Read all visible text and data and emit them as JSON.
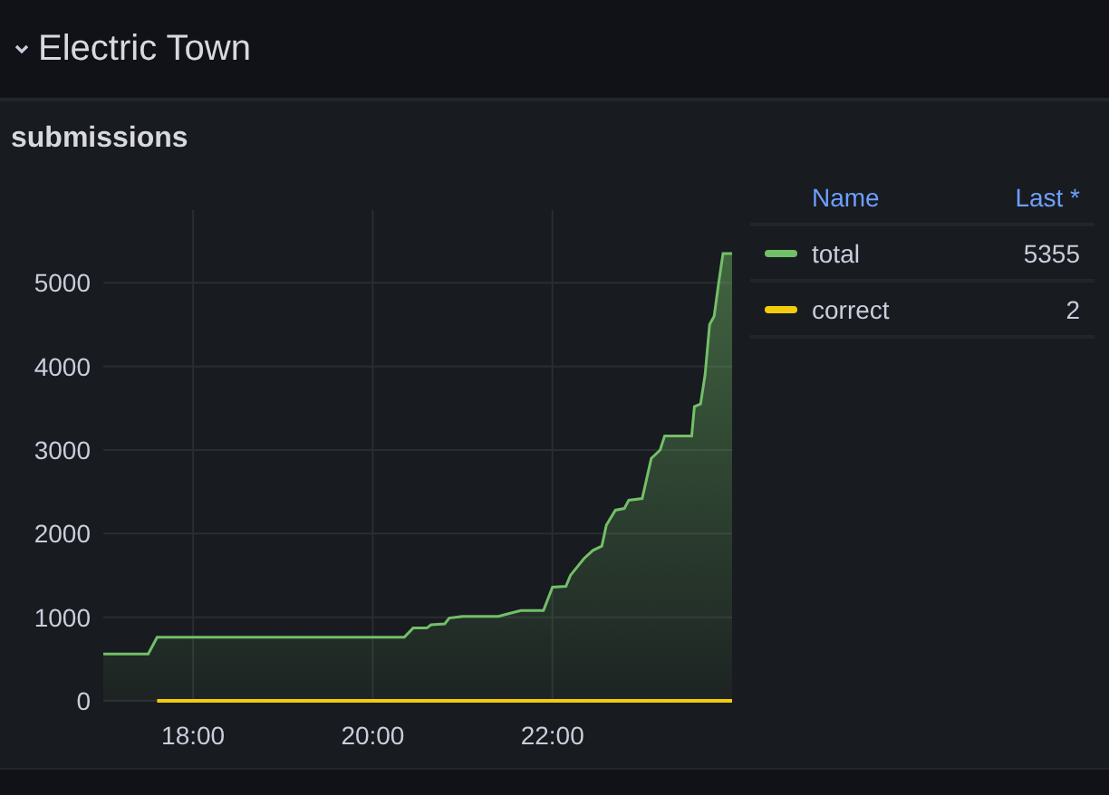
{
  "row_header": {
    "title": "Electric Town",
    "expanded": true
  },
  "panel": {
    "title": "submissions",
    "chart_data": {
      "type": "line",
      "grid": true,
      "x": [
        17.0,
        17.5,
        17.6,
        20.0,
        20.35,
        20.45,
        20.6,
        20.65,
        20.8,
        20.85,
        21.0,
        21.4,
        21.5,
        21.65,
        21.9,
        22.0,
        22.15,
        22.2,
        22.35,
        22.45,
        22.55,
        22.6,
        22.7,
        22.8,
        22.85,
        23.0,
        23.1,
        23.2,
        23.25,
        23.55,
        23.58,
        23.65,
        23.7,
        23.75,
        23.8,
        23.85,
        23.9,
        24.0
      ],
      "series": [
        {
          "name": "total",
          "color": "#73bf69",
          "type": "area",
          "values": [
            560,
            560,
            760,
            760,
            760,
            870,
            870,
            910,
            920,
            990,
            1010,
            1010,
            1040,
            1080,
            1080,
            1360,
            1370,
            1500,
            1700,
            1800,
            1850,
            2100,
            2280,
            2300,
            2400,
            2420,
            2900,
            3000,
            3170,
            3170,
            3520,
            3550,
            3900,
            4500,
            4600,
            5000,
            5350,
            5350
          ]
        },
        {
          "name": "correct",
          "color": "#f2cc0c",
          "values": [
            null,
            null,
            0,
            0,
            0,
            0,
            0,
            0,
            0,
            0,
            0,
            0,
            0,
            0,
            0,
            0,
            0,
            0,
            0,
            0,
            0,
            0,
            0,
            0,
            0,
            0,
            0,
            0,
            0,
            0,
            0,
            0,
            0,
            0,
            0,
            0,
            0,
            0
          ]
        }
      ],
      "xlim": [
        17.0,
        24.0
      ],
      "ylim": [
        0,
        5870
      ],
      "xticks": [
        {
          "value": 18,
          "label": "18:00"
        },
        {
          "value": 20,
          "label": "20:00"
        },
        {
          "value": 22,
          "label": "22:00"
        }
      ],
      "yticks": [
        0,
        1000,
        2000,
        3000,
        4000,
        5000
      ]
    },
    "legend": {
      "columns": [
        "Name",
        "Last *"
      ],
      "last": [
        "5355",
        "2"
      ]
    }
  }
}
